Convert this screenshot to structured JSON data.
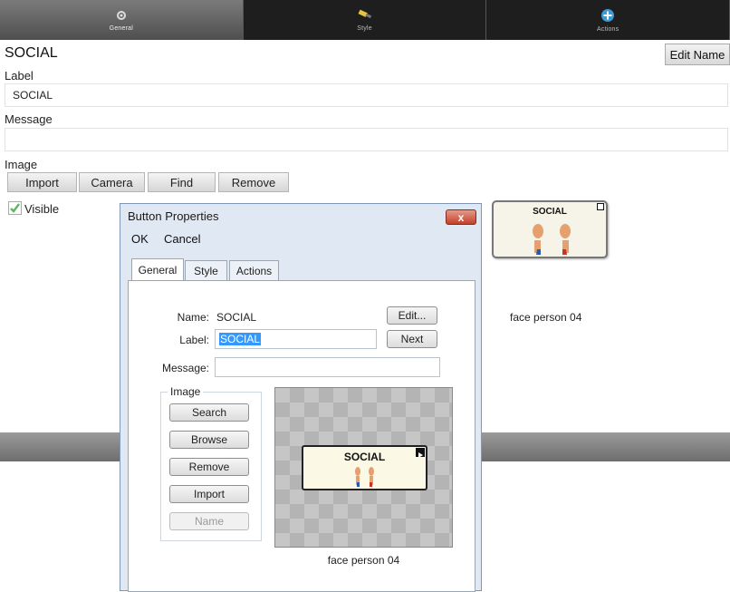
{
  "topbar": {
    "tabs": [
      {
        "label": "General",
        "icon": "gear-icon"
      },
      {
        "label": "Style",
        "icon": "paint-brush-icon"
      },
      {
        "label": "Actions",
        "icon": "plus-circle-icon"
      }
    ]
  },
  "header": {
    "title": "SOCIAL",
    "edit_name_label": "Edit Name"
  },
  "form": {
    "label_caption": "Label",
    "label_value": "SOCIAL",
    "message_caption": "Message",
    "message_value": "",
    "image_caption": "Image",
    "image_buttons": [
      "Import",
      "Camera",
      "Find",
      "Remove"
    ],
    "visible_label": "Visible",
    "visible_checked": true
  },
  "symbol": {
    "text": "SOCIAL",
    "caption": "face person 04"
  },
  "dialog": {
    "title": "Button Properties",
    "close_glyph": "x",
    "menu": [
      "OK",
      "Cancel"
    ],
    "tabs": [
      "General",
      "Style",
      "Actions"
    ],
    "name_caption": "Name:",
    "name_value": "SOCIAL",
    "edit_button": "Edit...",
    "label_caption": "Label:",
    "label_value": "SOCIAL",
    "next_button": "Next",
    "message_caption": "Message:",
    "message_value": "",
    "image_group_label": "Image",
    "image_buttons": [
      "Search",
      "Browse",
      "Remove",
      "Import",
      "Name"
    ],
    "preview_text": "SOCIAL",
    "preview_caption": "face person 04"
  },
  "colors": {
    "topbar": "#1e1e1e",
    "dialog_bg": "#dfe8f3",
    "close_button": "#c5402a",
    "selection": "#3399ff",
    "check": "#5cb85c"
  }
}
